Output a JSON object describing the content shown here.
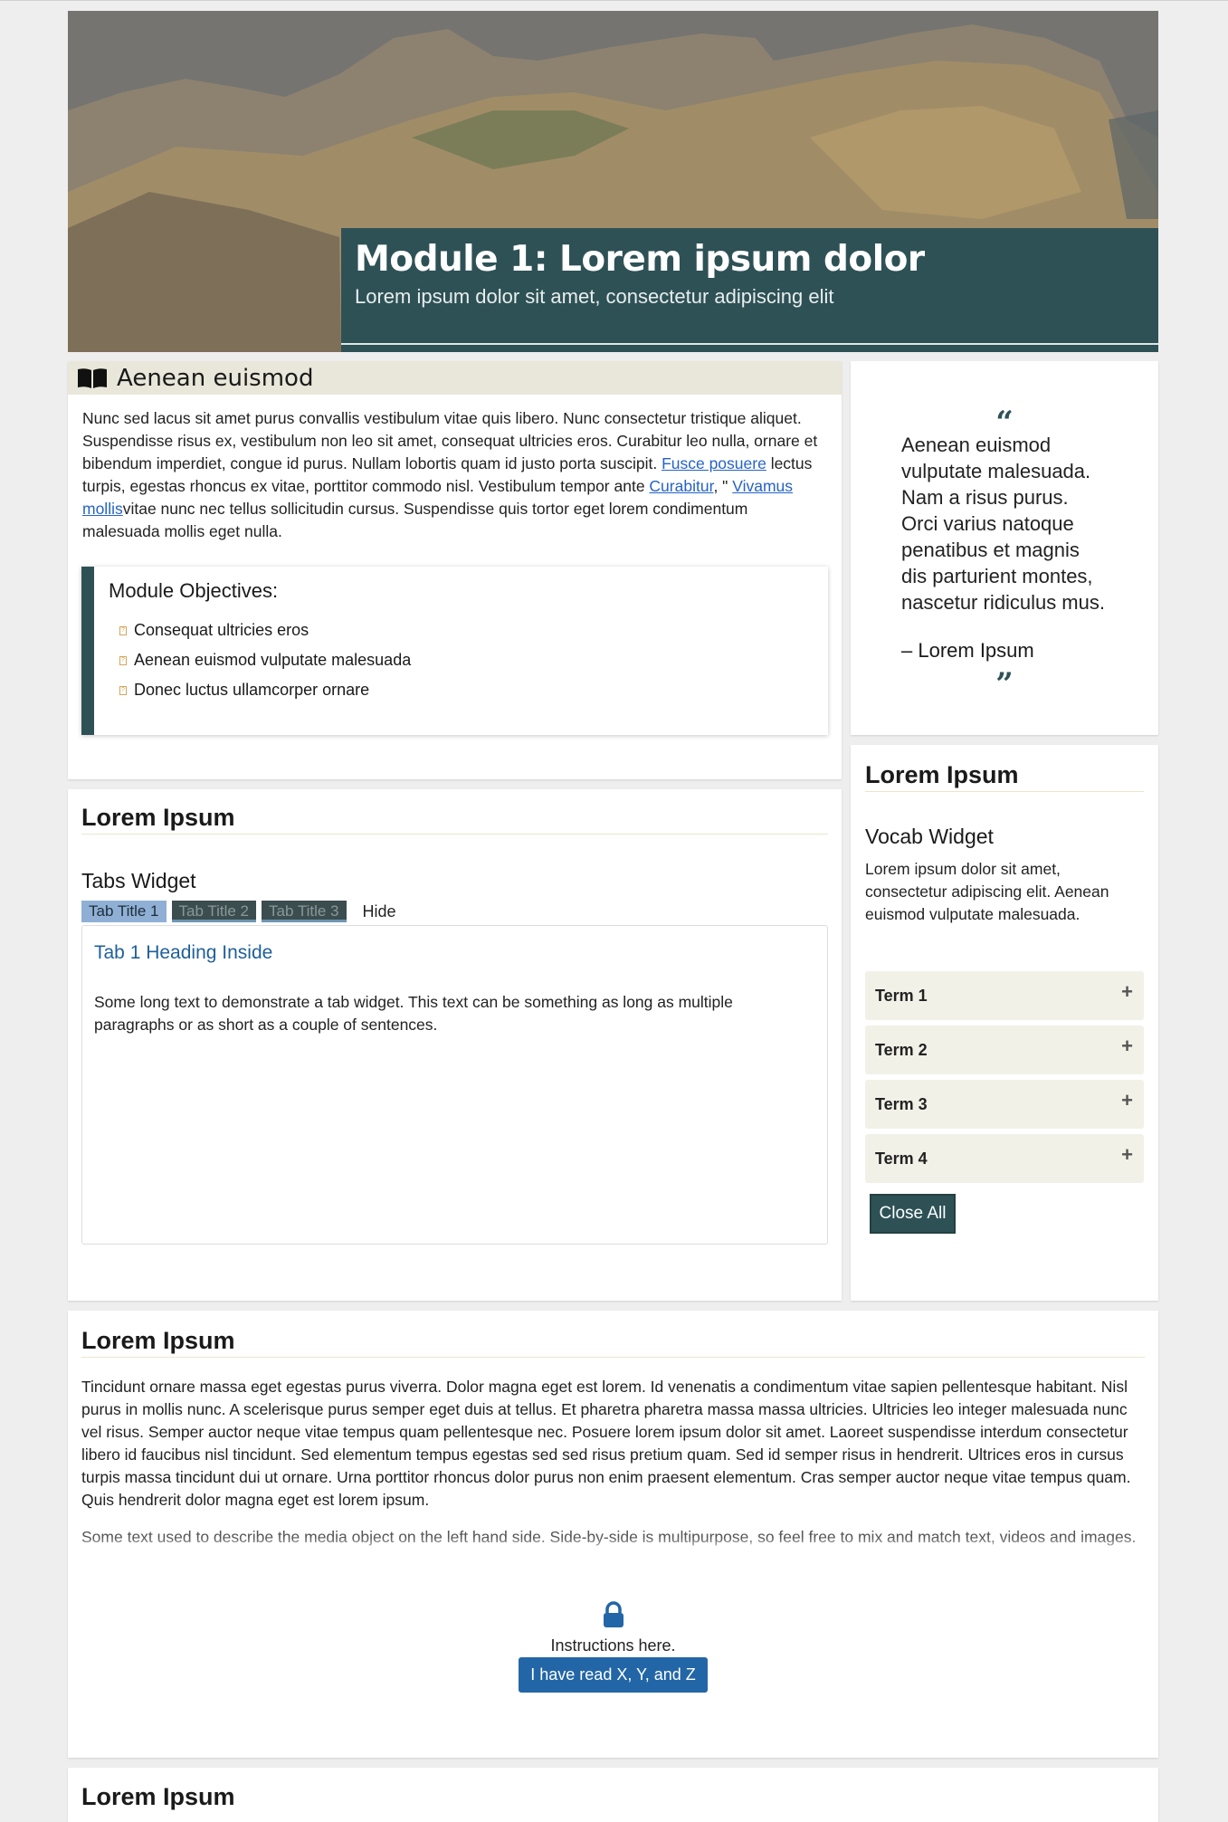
{
  "hero": {
    "title": "Module 1: Lorem ipsum dolor",
    "subtitle": "Lorem ipsum dolor sit amet, consectetur adipiscing elit"
  },
  "intro": {
    "heading": "Aenean euismod",
    "icon": "book-icon",
    "text_1": "Nunc sed lacus sit amet purus convallis vestibulum vitae quis libero. Nunc consectetur tristique aliquet. Suspendisse risus ex, vestibulum non leo sit amet, consequat ultricies eros. Curabitur leo nulla, ornare et bibendum imperdiet, congue id purus. Nullam lobortis quam id justo porta suscipit. ",
    "link_1": "Fusce posuere",
    "text_2": " lectus turpis, egestas rhoncus ex vitae, porttitor commodo nisl. Vestibulum tempor ante ",
    "link_2": "Curabitur",
    "text_3": ", \" ",
    "link_3": "Vivamus mollis",
    "text_4": "vitae nunc nec tellus sollicitudin cursus. Suspendisse quis tortor eget lorem condimentum malesuada mollis eget nulla.",
    "objectives": {
      "title": "Module Objectives:",
      "items": [
        "Consequat ultricies eros",
        "Aenean euismod vulputate malesuada",
        "Donec luctus ullamcorper ornare"
      ]
    }
  },
  "quote": {
    "open_mark": "“",
    "close_mark": "”",
    "text": "Aenean euismod vulputate malesuada. Nam a risus purus. Orci varius natoque penatibus et magnis dis parturient montes, nascetur ridiculus mus.",
    "author": "– Lorem Ipsum"
  },
  "tabs_section": {
    "title": "Lorem Ipsum",
    "widget_title": "Tabs Widget",
    "tabs": [
      "Tab Title 1",
      "Tab Title 2",
      "Tab Title 3"
    ],
    "hide_label": "Hide",
    "content_heading": "Tab 1 Heading Inside",
    "content_text": "Some long text to demonstrate a tab widget. This text can be something as long as multiple paragraphs or as short as a couple of sentences."
  },
  "vocab": {
    "title": "Lorem Ipsum",
    "widget_title": "Vocab Widget",
    "description": "Lorem ipsum dolor sit amet, consectetur adipiscing elit. Aenean euismod vulputate malesuada.",
    "terms": [
      "Term 1",
      "Term 2",
      "Term 3",
      "Term 4"
    ],
    "plus": "+",
    "close_all": "Close All"
  },
  "section3": {
    "title": "Lorem Ipsum",
    "text": "Tincidunt ornare massa eget egestas purus viverra. Dolor magna eget est lorem. Id venenatis a condimentum vitae sapien pellentesque habitant. Nisl purus in mollis nunc. A scelerisque purus semper eget duis at tellus. Et pharetra pharetra massa massa ultricies. Ultricies leo integer malesuada nunc vel risus. Semper auctor neque vitae tempus quam pellentesque nec. Posuere lorem ipsum dolor sit amet. Laoreet suspendisse interdum consectetur libero id faucibus nisl tincidunt. Sed elementum tempus egestas sed sed risus pretium quam. Sed id semper risus in hendrerit. Ultrices eros in cursus turpis massa tincidunt dui ut ornare. Urna porttitor rhoncus dolor purus non enim praesent elementum. Cras semper auctor neque vitae tempus quam. Quis hendrerit dolor magna eget est lorem ipsum.",
    "media_text": "Some text used to describe the media object on the left hand side. Side-by-side is multipurpose, so feel free to mix and match text, videos and images.",
    "lock_icon": "lock-icon",
    "instructions": "Instructions here.",
    "button": "I have read X, Y, and Z"
  },
  "section4": {
    "title": "Lorem Ipsum"
  },
  "colors": {
    "accent": "#2e5156",
    "button_blue": "#2366a7",
    "link": "#2563c7",
    "tab_active": "#8fb0d4"
  }
}
